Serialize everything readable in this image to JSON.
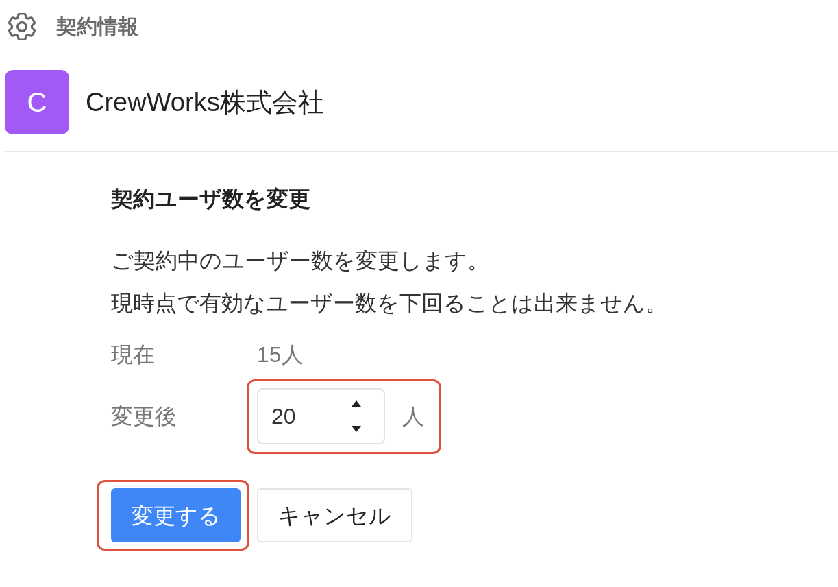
{
  "header": {
    "title": "契約情報"
  },
  "company": {
    "initial": "C",
    "name": "CrewWorks株式会社"
  },
  "form": {
    "title": "契約ユーザ数を変更",
    "paragraphs": [
      "ご契約中のユーザー数を変更します。",
      "現時点で有効なユーザー数を下回ることは出来ません。"
    ],
    "rows": [
      {
        "kind": "text",
        "label": "現在",
        "value": "15人",
        "highlighted": false
      },
      {
        "kind": "number",
        "label": "変更後",
        "value": "20",
        "unit": "人",
        "highlighted": true
      }
    ]
  },
  "buttons": [
    {
      "kind": "primary",
      "label": "変更する",
      "highlighted": true
    },
    {
      "kind": "secondary",
      "label": "キャンセル",
      "highlighted": false
    }
  ]
}
